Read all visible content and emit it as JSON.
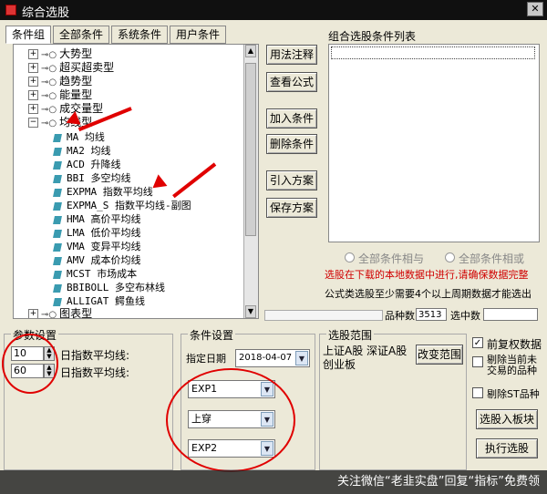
{
  "window": {
    "title": "综合选股",
    "close_glyph": "✕"
  },
  "tabs": [
    "条件组",
    "全部条件",
    "系统条件",
    "用户条件"
  ],
  "tree": {
    "categories_top": [
      "大势型",
      "超买超卖型",
      "趋势型",
      "能量型",
      "成交量型"
    ],
    "expanded": "均线型",
    "items": [
      "MA 均线",
      "MA2 均线",
      "ACD 升降线",
      "BBI 多空均线",
      "EXPMA 指数平均线",
      "EXPMA_S 指数平均线-副图",
      "HMA 高价平均线",
      "LMA 低价平均线",
      "VMA 变异平均线",
      "AMV 成本价均线",
      "MCST 市场成本",
      "BBIBOLL 多空布林线",
      "ALLIGAT 鳄鱼线"
    ],
    "categories_bottom": [
      "图表型"
    ]
  },
  "buttons": {
    "usage": "用法注释",
    "formula": "查看公式",
    "add": "加入条件",
    "delete": "删除条件",
    "import": "引入方案",
    "save": "保存方案",
    "change_range": "改变范围",
    "select_to_board": "选股入板块",
    "execute": "执行选股"
  },
  "condition_list": {
    "title": "组合选股条件列表"
  },
  "logic": {
    "and_label": "全部条件相与",
    "or_label": "全部条件相或"
  },
  "notes": {
    "red": "选股在下载的本地数据中进行,请确保数据完整",
    "black": "公式类选股至少需要4个以上周期数据才能选出"
  },
  "stats": {
    "count_label": "品种数",
    "count_value": "3513",
    "selected_label": "选中数"
  },
  "params": {
    "title": "参数设置",
    "rows": [
      {
        "value": "10",
        "label": "日指数平均线:"
      },
      {
        "value": "60",
        "label": "日指数平均线:"
      }
    ]
  },
  "condition_setting": {
    "title": "条件设置",
    "date_label": "指定日期",
    "date_value": "2018-04-07",
    "select1": "EXP1",
    "select2": "上穿",
    "select3": "EXP2"
  },
  "range": {
    "title": "选股范围",
    "text": "上证A股 深证A股 创业板"
  },
  "options": [
    {
      "label": "前复权数据",
      "checked": true
    },
    {
      "label": "剔除当前未交易的品种",
      "checked": false
    },
    {
      "label": "剔除ST品种",
      "checked": false
    }
  ],
  "watermark": "关注微信“老韭实盘”回复“指标”免费领",
  "colors": {
    "annotation": "#e00000",
    "leaf_icon": "#3a9bb0"
  }
}
